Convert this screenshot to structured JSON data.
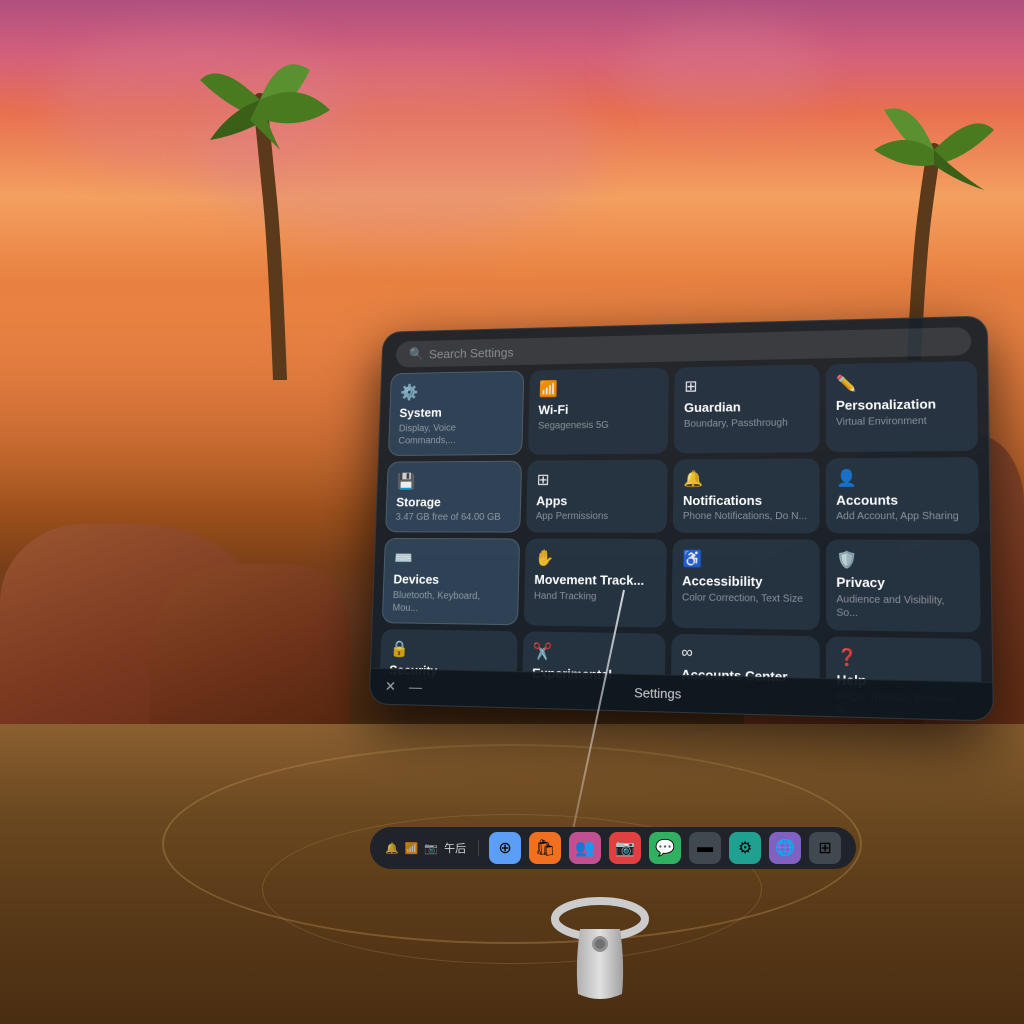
{
  "background": {
    "description": "VR sunset beach scene with palm trees and rock formations"
  },
  "settings_panel": {
    "title": "Settings",
    "search_placeholder": "Search Settings",
    "items": [
      {
        "id": "system",
        "icon": "⚙",
        "title": "System",
        "subtitle": "Display, Voice Commands,..."
      },
      {
        "id": "wifi",
        "icon": "📶",
        "title": "Wi-Fi",
        "subtitle": "Segagenesis 5G"
      },
      {
        "id": "guardian",
        "icon": "⊞",
        "title": "Guardian",
        "subtitle": "Boundary, Passthrough"
      },
      {
        "id": "personalization",
        "icon": "✏",
        "title": "Personalization",
        "subtitle": "Virtual Environment"
      },
      {
        "id": "storage",
        "icon": "▬",
        "title": "Storage",
        "subtitle": "3.47 GB free of 64.00 GB"
      },
      {
        "id": "apps",
        "icon": "⊞",
        "title": "Apps",
        "subtitle": "App Permissions"
      },
      {
        "id": "notifications",
        "icon": "🔔",
        "title": "Notifications",
        "subtitle": "Phone Notifications, Do N..."
      },
      {
        "id": "accounts",
        "icon": "👤",
        "title": "Accounts",
        "subtitle": "Add Account, App Sharing"
      },
      {
        "id": "devices",
        "icon": "⌨",
        "title": "Devices",
        "subtitle": "Bluetooth, Keyboard, Mou..."
      },
      {
        "id": "movement-track",
        "icon": "✋",
        "title": "Movement Track...",
        "subtitle": "Hand Tracking"
      },
      {
        "id": "accessibility",
        "icon": "♿",
        "title": "Accessibility",
        "subtitle": "Color Correction, Text Size"
      },
      {
        "id": "privacy",
        "icon": "🛡",
        "title": "Privacy",
        "subtitle": "Audience and Visibility, So..."
      },
      {
        "id": "security",
        "icon": "🔒",
        "title": "Security",
        "subtitle": ""
      },
      {
        "id": "experimental",
        "icon": "✂",
        "title": "Experimental",
        "subtitle": ""
      },
      {
        "id": "meta",
        "icon": "∞",
        "title": "Accounts Center",
        "subtitle": ""
      },
      {
        "id": "help",
        "icon": "❓",
        "title": "Help",
        "subtitle": "FAQs, Tutorials, Release N..."
      }
    ],
    "bottom_bar": {
      "close_label": "✕",
      "minimize_label": "—",
      "title": "Settings"
    }
  },
  "taskbar": {
    "status_icons": [
      "🔔",
      "📶",
      "📷"
    ],
    "time": "午后",
    "apps": [
      {
        "color": "#5b9ef5",
        "icon": "⊕"
      },
      {
        "color": "#f07020",
        "icon": "🛍"
      },
      {
        "color": "#c05090",
        "icon": "👥"
      },
      {
        "color": "#e04040",
        "icon": "📷"
      },
      {
        "color": "#30b060",
        "icon": "💬"
      },
      {
        "color": "#404850",
        "icon": "▬"
      },
      {
        "color": "#20a090",
        "icon": "⚙"
      },
      {
        "color": "#8060c0",
        "icon": "🌐"
      },
      {
        "color": "#404850",
        "icon": "⊞"
      }
    ]
  }
}
